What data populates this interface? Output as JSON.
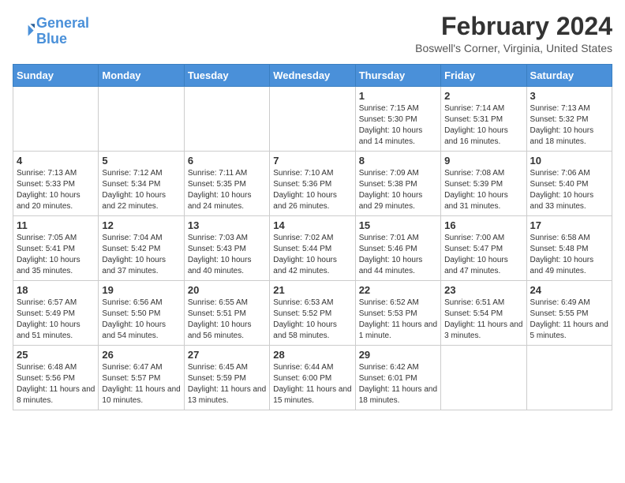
{
  "logo": {
    "line1": "General",
    "line2": "Blue"
  },
  "title": "February 2024",
  "subtitle": "Boswell's Corner, Virginia, United States",
  "days_of_week": [
    "Sunday",
    "Monday",
    "Tuesday",
    "Wednesday",
    "Thursday",
    "Friday",
    "Saturday"
  ],
  "weeks": [
    [
      {
        "day": "",
        "sunrise": "",
        "sunset": "",
        "daylight": "",
        "empty": true
      },
      {
        "day": "",
        "sunrise": "",
        "sunset": "",
        "daylight": "",
        "empty": true
      },
      {
        "day": "",
        "sunrise": "",
        "sunset": "",
        "daylight": "",
        "empty": true
      },
      {
        "day": "",
        "sunrise": "",
        "sunset": "",
        "daylight": "",
        "empty": true
      },
      {
        "day": "1",
        "sunrise": "Sunrise: 7:15 AM",
        "sunset": "Sunset: 5:30 PM",
        "daylight": "Daylight: 10 hours and 14 minutes."
      },
      {
        "day": "2",
        "sunrise": "Sunrise: 7:14 AM",
        "sunset": "Sunset: 5:31 PM",
        "daylight": "Daylight: 10 hours and 16 minutes."
      },
      {
        "day": "3",
        "sunrise": "Sunrise: 7:13 AM",
        "sunset": "Sunset: 5:32 PM",
        "daylight": "Daylight: 10 hours and 18 minutes."
      }
    ],
    [
      {
        "day": "4",
        "sunrise": "Sunrise: 7:13 AM",
        "sunset": "Sunset: 5:33 PM",
        "daylight": "Daylight: 10 hours and 20 minutes."
      },
      {
        "day": "5",
        "sunrise": "Sunrise: 7:12 AM",
        "sunset": "Sunset: 5:34 PM",
        "daylight": "Daylight: 10 hours and 22 minutes."
      },
      {
        "day": "6",
        "sunrise": "Sunrise: 7:11 AM",
        "sunset": "Sunset: 5:35 PM",
        "daylight": "Daylight: 10 hours and 24 minutes."
      },
      {
        "day": "7",
        "sunrise": "Sunrise: 7:10 AM",
        "sunset": "Sunset: 5:36 PM",
        "daylight": "Daylight: 10 hours and 26 minutes."
      },
      {
        "day": "8",
        "sunrise": "Sunrise: 7:09 AM",
        "sunset": "Sunset: 5:38 PM",
        "daylight": "Daylight: 10 hours and 29 minutes."
      },
      {
        "day": "9",
        "sunrise": "Sunrise: 7:08 AM",
        "sunset": "Sunset: 5:39 PM",
        "daylight": "Daylight: 10 hours and 31 minutes."
      },
      {
        "day": "10",
        "sunrise": "Sunrise: 7:06 AM",
        "sunset": "Sunset: 5:40 PM",
        "daylight": "Daylight: 10 hours and 33 minutes."
      }
    ],
    [
      {
        "day": "11",
        "sunrise": "Sunrise: 7:05 AM",
        "sunset": "Sunset: 5:41 PM",
        "daylight": "Daylight: 10 hours and 35 minutes."
      },
      {
        "day": "12",
        "sunrise": "Sunrise: 7:04 AM",
        "sunset": "Sunset: 5:42 PM",
        "daylight": "Daylight: 10 hours and 37 minutes."
      },
      {
        "day": "13",
        "sunrise": "Sunrise: 7:03 AM",
        "sunset": "Sunset: 5:43 PM",
        "daylight": "Daylight: 10 hours and 40 minutes."
      },
      {
        "day": "14",
        "sunrise": "Sunrise: 7:02 AM",
        "sunset": "Sunset: 5:44 PM",
        "daylight": "Daylight: 10 hours and 42 minutes."
      },
      {
        "day": "15",
        "sunrise": "Sunrise: 7:01 AM",
        "sunset": "Sunset: 5:46 PM",
        "daylight": "Daylight: 10 hours and 44 minutes."
      },
      {
        "day": "16",
        "sunrise": "Sunrise: 7:00 AM",
        "sunset": "Sunset: 5:47 PM",
        "daylight": "Daylight: 10 hours and 47 minutes."
      },
      {
        "day": "17",
        "sunrise": "Sunrise: 6:58 AM",
        "sunset": "Sunset: 5:48 PM",
        "daylight": "Daylight: 10 hours and 49 minutes."
      }
    ],
    [
      {
        "day": "18",
        "sunrise": "Sunrise: 6:57 AM",
        "sunset": "Sunset: 5:49 PM",
        "daylight": "Daylight: 10 hours and 51 minutes."
      },
      {
        "day": "19",
        "sunrise": "Sunrise: 6:56 AM",
        "sunset": "Sunset: 5:50 PM",
        "daylight": "Daylight: 10 hours and 54 minutes."
      },
      {
        "day": "20",
        "sunrise": "Sunrise: 6:55 AM",
        "sunset": "Sunset: 5:51 PM",
        "daylight": "Daylight: 10 hours and 56 minutes."
      },
      {
        "day": "21",
        "sunrise": "Sunrise: 6:53 AM",
        "sunset": "Sunset: 5:52 PM",
        "daylight": "Daylight: 10 hours and 58 minutes."
      },
      {
        "day": "22",
        "sunrise": "Sunrise: 6:52 AM",
        "sunset": "Sunset: 5:53 PM",
        "daylight": "Daylight: 11 hours and 1 minute."
      },
      {
        "day": "23",
        "sunrise": "Sunrise: 6:51 AM",
        "sunset": "Sunset: 5:54 PM",
        "daylight": "Daylight: 11 hours and 3 minutes."
      },
      {
        "day": "24",
        "sunrise": "Sunrise: 6:49 AM",
        "sunset": "Sunset: 5:55 PM",
        "daylight": "Daylight: 11 hours and 5 minutes."
      }
    ],
    [
      {
        "day": "25",
        "sunrise": "Sunrise: 6:48 AM",
        "sunset": "Sunset: 5:56 PM",
        "daylight": "Daylight: 11 hours and 8 minutes."
      },
      {
        "day": "26",
        "sunrise": "Sunrise: 6:47 AM",
        "sunset": "Sunset: 5:57 PM",
        "daylight": "Daylight: 11 hours and 10 minutes."
      },
      {
        "day": "27",
        "sunrise": "Sunrise: 6:45 AM",
        "sunset": "Sunset: 5:59 PM",
        "daylight": "Daylight: 11 hours and 13 minutes."
      },
      {
        "day": "28",
        "sunrise": "Sunrise: 6:44 AM",
        "sunset": "Sunset: 6:00 PM",
        "daylight": "Daylight: 11 hours and 15 minutes."
      },
      {
        "day": "29",
        "sunrise": "Sunrise: 6:42 AM",
        "sunset": "Sunset: 6:01 PM",
        "daylight": "Daylight: 11 hours and 18 minutes."
      },
      {
        "day": "",
        "sunrise": "",
        "sunset": "",
        "daylight": "",
        "empty": true
      },
      {
        "day": "",
        "sunrise": "",
        "sunset": "",
        "daylight": "",
        "empty": true
      }
    ]
  ]
}
